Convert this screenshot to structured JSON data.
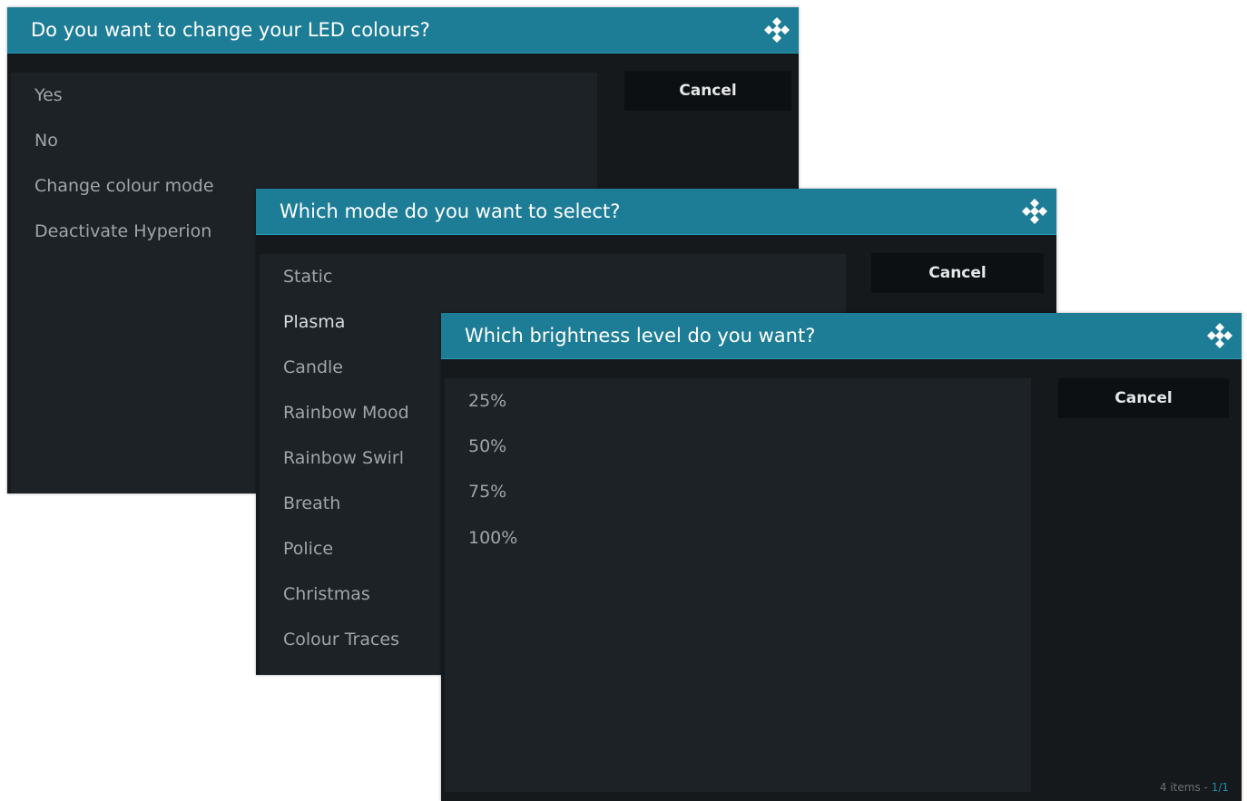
{
  "dialog_led": {
    "title": "Do you want to change your LED colours?",
    "items": [
      "Yes",
      "No",
      "Change colour mode",
      "Deactivate Hyperion"
    ],
    "cancel_label": "Cancel"
  },
  "dialog_mode": {
    "title": "Which mode do you want to select?",
    "items": [
      "Static",
      "Plasma",
      "Candle",
      "Rainbow Mood",
      "Rainbow Swirl",
      "Breath",
      "Police",
      "Christmas",
      "Colour Traces"
    ],
    "cancel_label": "Cancel"
  },
  "dialog_brightness": {
    "title": "Which brightness level do you want?",
    "items": [
      "25%",
      "50%",
      "75%",
      "100%"
    ],
    "cancel_label": "Cancel",
    "items_count": "4 items",
    "page": "1/1"
  },
  "colors": {
    "titlebar": "#1e7d96",
    "background": "#15191c",
    "list_panel": "#1d2226",
    "cancel_button": "#0d1012"
  },
  "icons": {
    "titlebar_logo": "kodi-logo-icon"
  }
}
